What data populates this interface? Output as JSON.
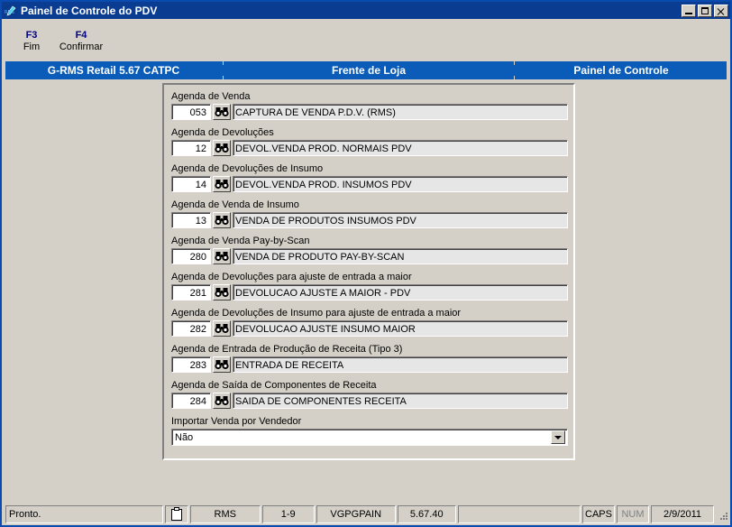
{
  "window": {
    "title": "Painel de Controle do PDV",
    "icon": "rms-app-icon",
    "buttons": {
      "minimize": "minimize-icon",
      "maximize": "maximize-icon",
      "close": "close-icon"
    }
  },
  "function_keys": [
    {
      "key": "F3",
      "label": "Fim"
    },
    {
      "key": "F4",
      "label": "Confirmar"
    }
  ],
  "tabs": [
    {
      "label": "G-RMS Retail 5.67 CATPC"
    },
    {
      "label": "Frente de Loja"
    },
    {
      "label": "Painel de Controle"
    }
  ],
  "fields": [
    {
      "label": "Agenda de Venda",
      "code": "053",
      "description": "CAPTURA DE VENDA P.D.V. (RMS)",
      "lookup_icon": "binoculars-icon"
    },
    {
      "label": "Agenda de Devoluções",
      "code": "12",
      "description": "DEVOL.VENDA PROD. NORMAIS PDV",
      "lookup_icon": "binoculars-icon"
    },
    {
      "label": "Agenda de Devoluções de Insumo",
      "code": "14",
      "description": "DEVOL.VENDA PROD. INSUMOS PDV",
      "lookup_icon": "binoculars-icon"
    },
    {
      "label": "Agenda de Venda de Insumo",
      "code": "13",
      "description": "VENDA DE PRODUTOS INSUMOS PDV",
      "lookup_icon": "binoculars-icon"
    },
    {
      "label": "Agenda de Venda Pay-by-Scan",
      "code": "280",
      "description": "VENDA DE PRODUTO PAY-BY-SCAN",
      "lookup_icon": "binoculars-icon"
    },
    {
      "label": "Agenda de Devoluções para ajuste de entrada a maior",
      "code": "281",
      "description": "DEVOLUCAO AJUSTE A MAIOR - PDV",
      "lookup_icon": "binoculars-icon"
    },
    {
      "label": "Agenda de Devoluções de Insumo  para ajuste de entrada a maior",
      "code": "282",
      "description": "DEVOLUCAO AJUSTE INSUMO MAIOR",
      "lookup_icon": "binoculars-icon"
    },
    {
      "label": "Agenda de Entrada de Produção de Receita (Tipo 3)",
      "code": "283",
      "description": "ENTRADA DE RECEITA",
      "lookup_icon": "binoculars-icon"
    },
    {
      "label": "Agenda de Saída de Componentes de Receita",
      "code": "284",
      "description": "SAIDA DE COMPONENTES RECEITA",
      "lookup_icon": "binoculars-icon"
    }
  ],
  "combo": {
    "label": "Importar Venda por Vendedor",
    "value": "Não",
    "arrow_icon": "chevron-down-icon"
  },
  "statusbar": {
    "message": "Pronto.",
    "clipboard_icon": "clipboard-icon",
    "system": "RMS",
    "position": "1-9",
    "program": "VGPGPAIN",
    "version": "5.67.40",
    "blank": "",
    "caps": "CAPS",
    "num": "NUM",
    "date": "2/9/2011",
    "grip_icon": "resize-grip-icon"
  },
  "colors": {
    "titlebar": "#0a3a8c",
    "tab_blue": "#0a5cb8",
    "face": "#d4d0c8",
    "fn_key": "#000080",
    "readonly_field": "#e6e6e6"
  }
}
